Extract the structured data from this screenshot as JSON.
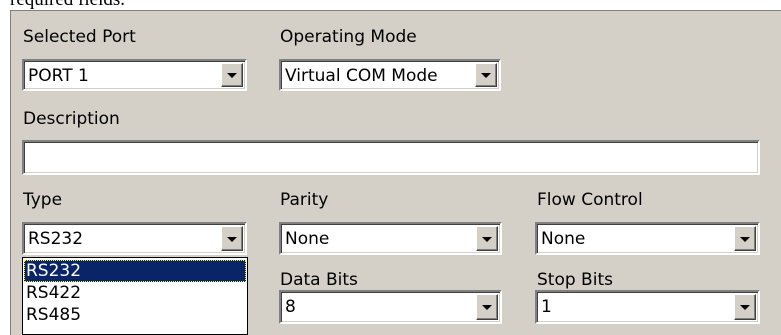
{
  "top_text": "required fields.",
  "selected_port": {
    "label": "Selected Port",
    "value": "PORT 1"
  },
  "operating_mode": {
    "label": "Operating Mode",
    "value": "Virtual COM Mode"
  },
  "description": {
    "label": "Description",
    "value": ""
  },
  "type": {
    "label": "Type",
    "value": "RS232",
    "options": [
      "RS232",
      "RS422",
      "RS485"
    ],
    "highlighted": "RS232"
  },
  "parity": {
    "label": "Parity",
    "value": "None"
  },
  "flow_control": {
    "label": "Flow Control",
    "value": "None"
  },
  "data_bits": {
    "label": "Data Bits",
    "value": "8"
  },
  "stop_bits": {
    "label": "Stop Bits",
    "value": "1"
  }
}
